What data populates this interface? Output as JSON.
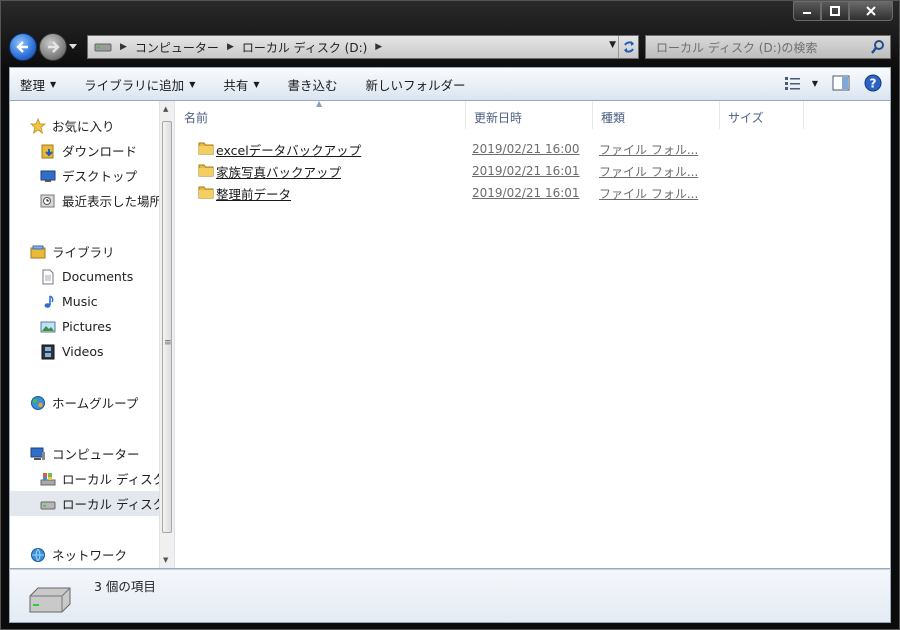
{
  "address": {
    "crumbs": [
      "コンピューター",
      "ローカル ディスク (D:)"
    ]
  },
  "search": {
    "placeholder": "ローカル ディスク (D:)の検索"
  },
  "toolbar": {
    "organize": "整理",
    "add_library": "ライブラリに追加",
    "share": "共有",
    "burn": "書き込む",
    "new_folder": "新しいフォルダー"
  },
  "nav": {
    "favorites": "お気に入り",
    "downloads": "ダウンロード",
    "desktop": "デスクトップ",
    "recent": "最近表示した場所",
    "libraries": "ライブラリ",
    "documents": "Documents",
    "music": "Music",
    "pictures": "Pictures",
    "videos": "Videos",
    "homegroup": "ホームグループ",
    "computer": "コンピューター",
    "local_c": "ローカル ディスク (C:)",
    "local_d": "ローカル ディスク (D:)",
    "network": "ネットワーク"
  },
  "columns": {
    "name": "名前",
    "date": "更新日時",
    "type": "種類",
    "size": "サイズ"
  },
  "files": [
    {
      "name": "excelデータバックアップ",
      "date": "2019/02/21 16:00",
      "type": "ファイル フォル..."
    },
    {
      "name": "家族写真バックアップ",
      "date": "2019/02/21 16:01",
      "type": "ファイル フォル..."
    },
    {
      "name": "整理前データ",
      "date": "2019/02/21 16:01",
      "type": "ファイル フォル..."
    }
  ],
  "status": {
    "count": "3 個の項目"
  },
  "colors": {
    "folder": "#e8b93b",
    "accent": "#2c6fd6"
  }
}
